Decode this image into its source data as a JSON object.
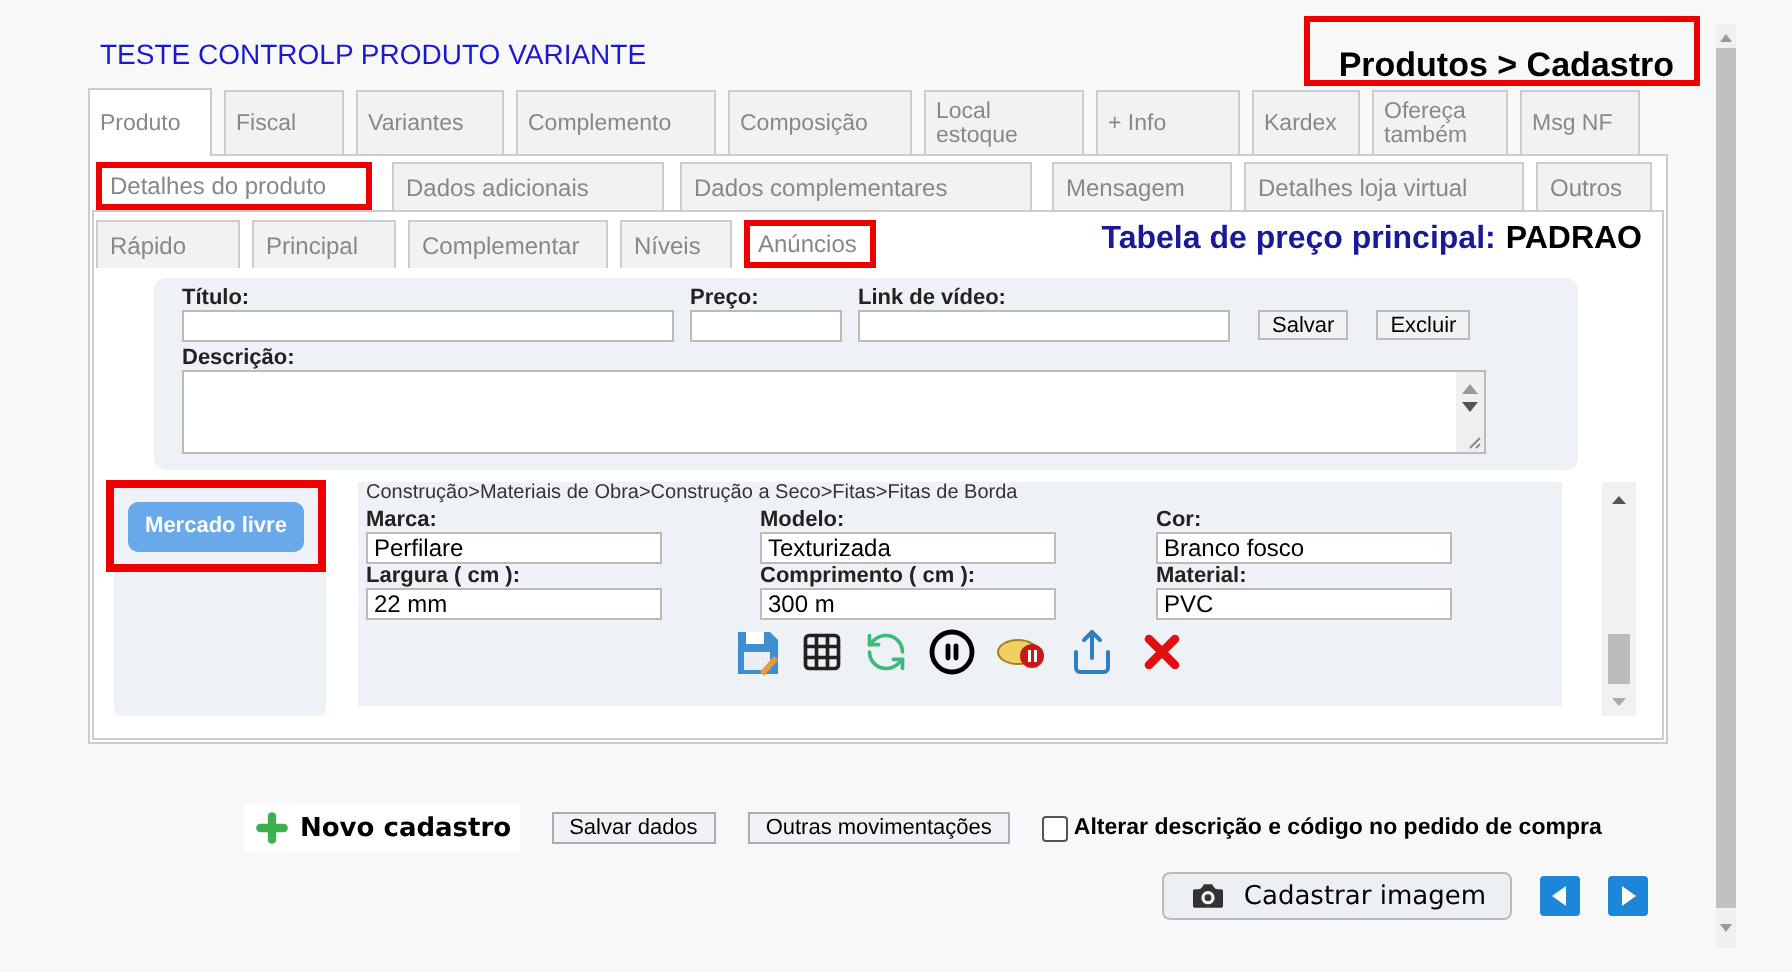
{
  "header": {
    "title": "TESTE CONTROLP PRODUTO VARIANTE",
    "breadcrumb": {
      "text": "Produtos > Cadastro",
      "highlighted": true
    }
  },
  "main_tabs": [
    {
      "label": "Produto",
      "selected": true
    },
    {
      "label": "Fiscal",
      "selected": false
    },
    {
      "label": "Variantes",
      "selected": false
    },
    {
      "label": "Complemento",
      "selected": false
    },
    {
      "label": "Composição",
      "selected": false
    },
    {
      "label": "Local estoque",
      "selected": false
    },
    {
      "label": "+ Info",
      "selected": false
    },
    {
      "label": "Kardex",
      "selected": false
    },
    {
      "label": "Ofereça também",
      "selected": false
    },
    {
      "label": "Msg NF",
      "selected": false
    }
  ],
  "sub_tabs": [
    {
      "label": "Detalhes do produto",
      "selected": true,
      "highlighted": true
    },
    {
      "label": "Dados adicionais",
      "selected": false,
      "highlighted": false
    },
    {
      "label": "Dados complementares",
      "selected": false,
      "highlighted": false
    },
    {
      "label": "Mensagem",
      "selected": false,
      "highlighted": false
    },
    {
      "label": "Detalhes loja virtual",
      "selected": false,
      "highlighted": false
    },
    {
      "label": "Outros",
      "selected": false,
      "highlighted": false
    }
  ],
  "section_tabs": [
    {
      "label": "Rápido",
      "selected": false,
      "highlighted": false
    },
    {
      "label": "Principal",
      "selected": false,
      "highlighted": false
    },
    {
      "label": "Complementar",
      "selected": false,
      "highlighted": false
    },
    {
      "label": "Níveis",
      "selected": false,
      "highlighted": false
    },
    {
      "label": "Anúncios",
      "selected": true,
      "highlighted": true
    }
  ],
  "price_table": {
    "label": "Tabela de preço principal:",
    "value": "PADRAO"
  },
  "ad_form": {
    "fields": [
      {
        "label": "Título:"
      },
      {
        "label": "Preço:"
      },
      {
        "label": "Link de vídeo:"
      }
    ],
    "buttons": [
      "Salvar",
      "Excluir"
    ],
    "description": {
      "label": "Descrição:"
    }
  },
  "marketplace": {
    "button": "Mercado livre",
    "highlighted": true
  },
  "listing": {
    "category_path": "Construção>Materiais de Obra>Construção a Seco>Fitas>Fitas de Borda",
    "attributes": [
      {
        "label": "Marca:",
        "value": "Perfilare"
      },
      {
        "label": "Modelo:",
        "value": "Texturizada"
      },
      {
        "label": "Cor:",
        "value": "Branco fosco"
      },
      {
        "label": "Largura ( cm ):",
        "value": "22 mm"
      },
      {
        "label": "Comprimento ( cm ):",
        "value": "300 m"
      },
      {
        "label": "Material:",
        "value": "PVC"
      }
    ]
  },
  "footer": {
    "new_button": "Novo cadastro",
    "buttons": [
      "Salvar dados",
      "Outras movimentações"
    ],
    "checkbox": {
      "label": "Alterar descrição e código no pedido de compra",
      "checked": false
    },
    "camera_button": "Cadastrar imagem"
  }
}
